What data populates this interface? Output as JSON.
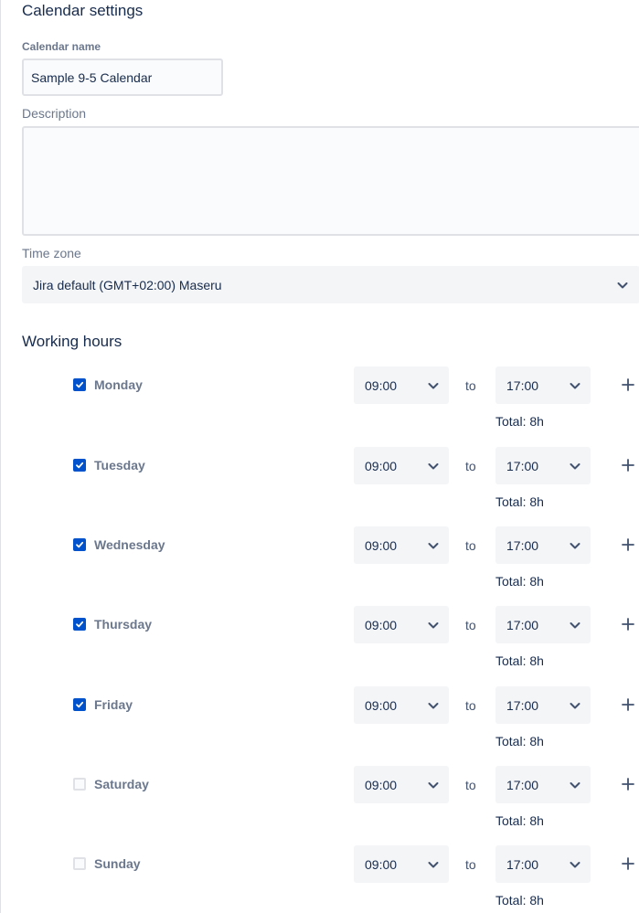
{
  "settings": {
    "title": "Calendar settings",
    "calendar_name": {
      "label": "Calendar name",
      "value": "Sample 9-5 Calendar"
    },
    "description": {
      "label": "Description",
      "value": ""
    },
    "time_zone": {
      "label": "Time zone",
      "value": "Jira default (GMT+02:00) Maseru",
      "icon": "chevron-down-icon"
    }
  },
  "working_hours": {
    "title": "Working hours",
    "to_label": "to",
    "days": [
      {
        "name": "Monday",
        "checked": true,
        "from": "09:00",
        "to": "17:00",
        "total": "Total: 8h"
      },
      {
        "name": "Tuesday",
        "checked": true,
        "from": "09:00",
        "to": "17:00",
        "total": "Total: 8h"
      },
      {
        "name": "Wednesday",
        "checked": true,
        "from": "09:00",
        "to": "17:00",
        "total": "Total: 8h"
      },
      {
        "name": "Thursday",
        "checked": true,
        "from": "09:00",
        "to": "17:00",
        "total": "Total: 8h"
      },
      {
        "name": "Friday",
        "checked": true,
        "from": "09:00",
        "to": "17:00",
        "total": "Total: 8h"
      },
      {
        "name": "Saturday",
        "checked": false,
        "from": "09:00",
        "to": "17:00",
        "total": "Total: 8h"
      },
      {
        "name": "Sunday",
        "checked": false,
        "from": "09:00",
        "to": "17:00",
        "total": "Total: 8h"
      }
    ]
  },
  "colors": {
    "accent": "#0052cc",
    "text": "#172b4d",
    "muted": "#6b778c",
    "field_background": "#f4f5f7",
    "border": "#dfe1e6"
  }
}
